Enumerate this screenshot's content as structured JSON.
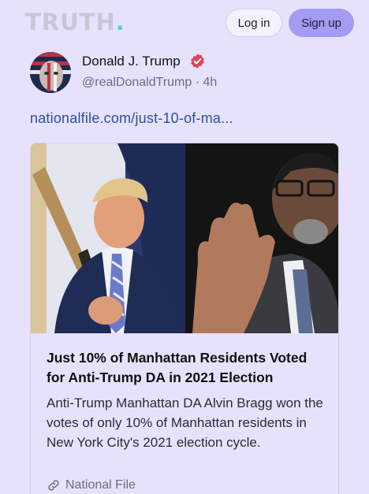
{
  "header": {
    "logo_text": "TRUTH",
    "logo_dot": ".",
    "login_label": "Log in",
    "signup_label": "Sign up"
  },
  "post": {
    "author_name": "Donald J. Trump",
    "author_handle": "@realDonaldTrump",
    "timestamp": "4h",
    "link_text": "nationalfile.com/just-10-of-ma...",
    "card": {
      "title": "Just 10% of Manhattan Residents Voted for Anti-Trump DA in 2021 Election",
      "description": "Anti-Trump Manhattan DA Alvin Bragg won the votes of only 10% of Manhattan residents in New York City's 2021 election cycle.",
      "source": "National File"
    }
  },
  "colors": {
    "background": "#e6e2fb",
    "accent": "#a49bf3",
    "link": "#2c4f9c",
    "verified": "#e0455c"
  }
}
